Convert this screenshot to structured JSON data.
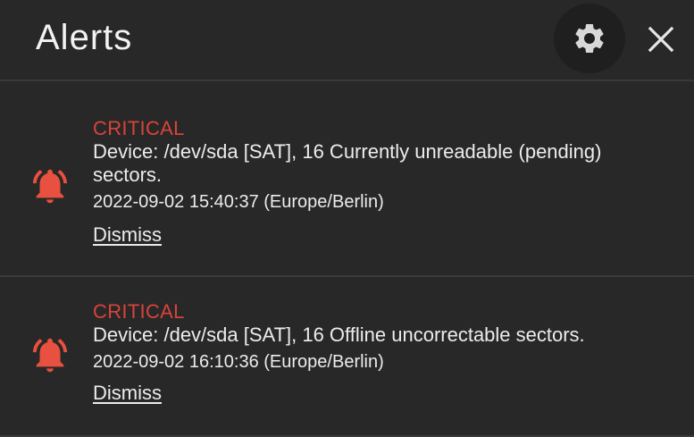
{
  "header": {
    "title": "Alerts",
    "settings_icon": "gear-icon",
    "close_icon": "close-icon"
  },
  "alerts": [
    {
      "level": "CRITICAL",
      "message": "Device: /dev/sda [SAT], 16 Currently unreadable (pending) sectors.",
      "timestamp": "2022-09-02 15:40:37 (Europe/Berlin)",
      "dismiss_label": "Dismiss",
      "icon": "bell-alert-icon"
    },
    {
      "level": "CRITICAL",
      "message": "Device: /dev/sda [SAT], 16 Offline uncorrectable sectors.",
      "timestamp": "2022-09-02 16:10:36 (Europe/Berlin)",
      "dismiss_label": "Dismiss",
      "icon": "bell-alert-icon"
    }
  ],
  "colors": {
    "background": "#282828",
    "critical": "#d9433a",
    "text": "#ececec",
    "divider": "#3a3a3a"
  }
}
